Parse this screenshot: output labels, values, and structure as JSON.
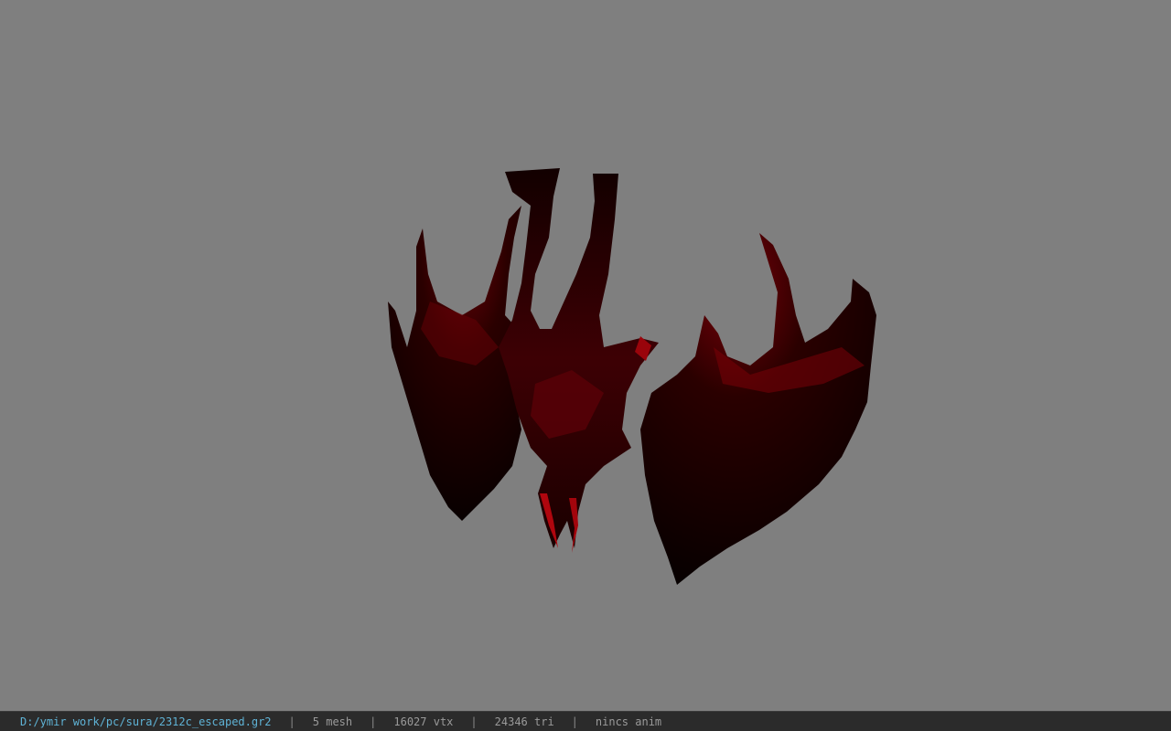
{
  "viewer": {
    "background_color": "#7f7f7f",
    "model_colors": {
      "dark": "#0a0000",
      "mid": "#3a0000",
      "bright": "#c40a12"
    }
  },
  "status": {
    "file_path": "D:/ymir work/pc/sura/2312c_escaped.gr2",
    "mesh": "5 mesh",
    "vertices": "16027 vtx",
    "triangles": "24346 tri",
    "animation": "nincs anim",
    "separator": "|"
  }
}
